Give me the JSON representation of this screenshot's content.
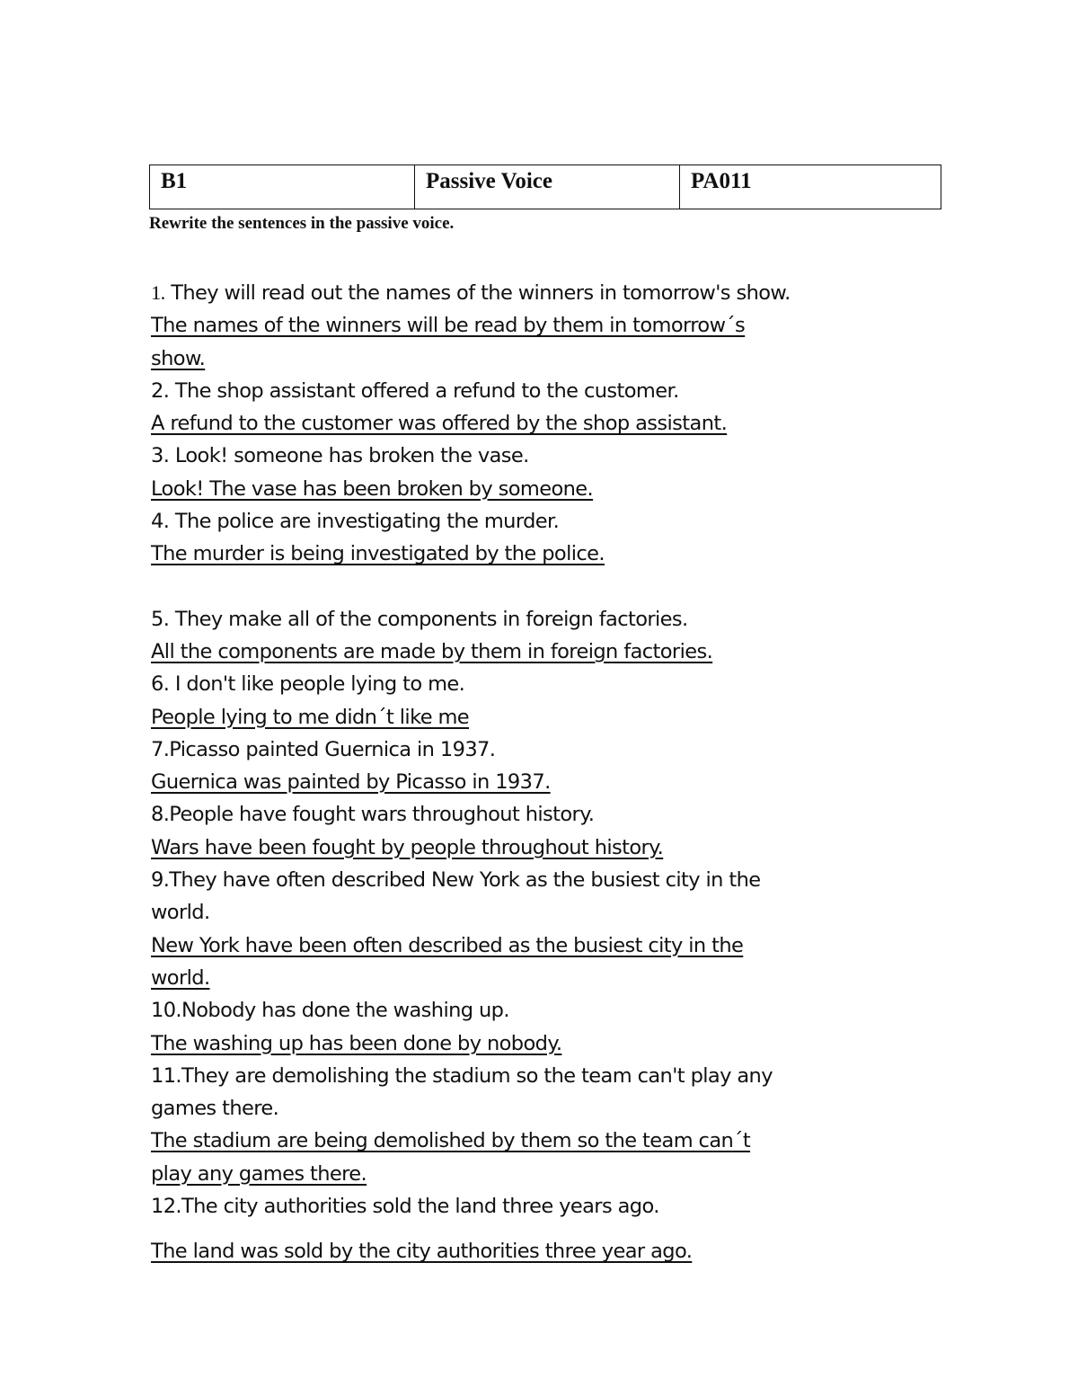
{
  "header": {
    "level": "B1",
    "topic": "Passive Voice",
    "code": "PA011"
  },
  "instruction": "Rewrite the sentences in the passive voice.",
  "items": [
    {
      "number": "1.",
      "question": " They will read out the names of the winners in tomorrow's show.",
      "answer_lines": [
        "The names of the winners will be read by them in tomorrow´s",
        "show."
      ]
    },
    {
      "number": "2.",
      "question": " The shop assistant offered a refund to the customer.",
      "answer_lines": [
        "A refund to the customer was offered by the shop assistant."
      ]
    },
    {
      "number": "3.",
      "question": " Look! someone has broken the vase.",
      "answer_lines": [
        "Look! The vase has been broken by someone."
      ]
    },
    {
      "number": "4.",
      "question": " The police are investigating the murder.",
      "answer_lines": [
        "The murder is being investigated by the police."
      ]
    },
    {
      "number": "5.",
      "question": " They make all of the components in foreign factories.",
      "answer_lines": [
        "All the components are made by them in foreign factories."
      ]
    },
    {
      "number": "6.",
      "question": " I don't like people lying to me.",
      "answer_lines": [
        "People lying to me didn´t like me"
      ]
    },
    {
      "number": "7.",
      "question": "Picasso painted Guernica in 1937.",
      "answer_lines": [
        "Guernica was painted by Picasso in 1937."
      ]
    },
    {
      "number": "8.",
      "question": "People have fought wars throughout history.",
      "answer_lines": [
        "Wars have been fought by people throughout history."
      ]
    },
    {
      "number": "9.",
      "question_lines": [
        "They have often described New York as the busiest city in the",
        "world."
      ],
      "answer_lines": [
        "New York have been often described as the busiest city in the",
        "world."
      ]
    },
    {
      "number": "10.",
      "question": "Nobody has done the washing up.",
      "answer_lines": [
        "The washing up has been done by nobody."
      ]
    },
    {
      "number": "11.",
      "question_lines": [
        "They are demolishing the stadium so the team can't play any",
        "games there."
      ],
      "answer_lines": [
        "The stadium are being demolished by them so the team can´t",
        "play any games there."
      ]
    },
    {
      "number": "12.",
      "question": "The city authorities sold the land three years ago.",
      "answer_lines": [
        "The land was sold by the city authorities three year ago."
      ]
    }
  ]
}
